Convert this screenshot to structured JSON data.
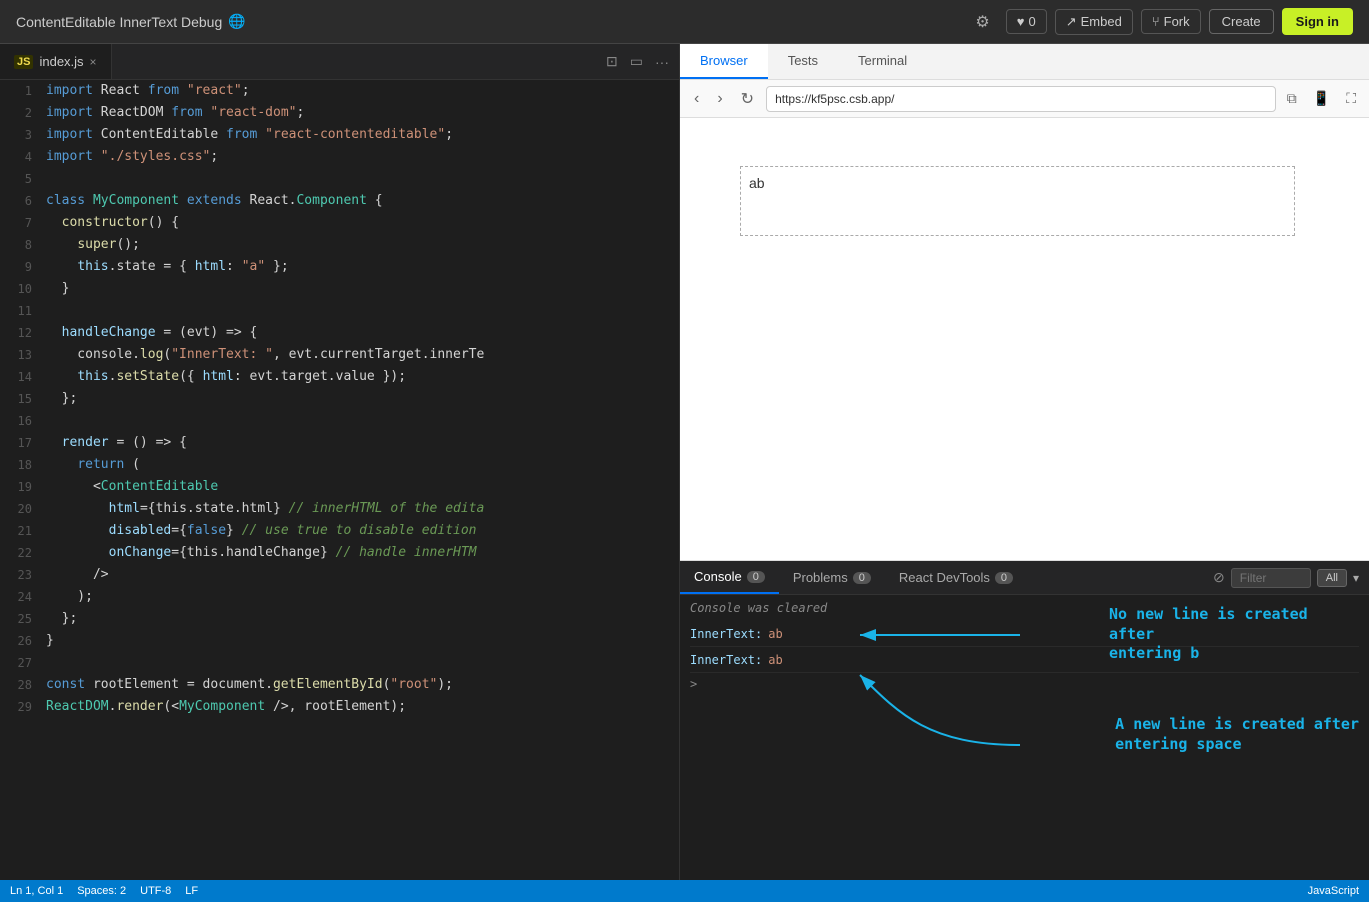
{
  "topbar": {
    "title": "ContentEditable InnerText Debug",
    "globe_icon": "🌐",
    "gear_label": "⚙",
    "likes_icon": "♥",
    "likes_count": "0",
    "embed_icon": "→",
    "embed_label": "Embed",
    "fork_icon": "⑂",
    "fork_label": "Fork",
    "create_label": "Create",
    "signin_label": "Sign in"
  },
  "editor": {
    "tab_label": "index.js",
    "js_badge": "JS"
  },
  "browser": {
    "tab_browser": "Browser",
    "tab_tests": "Tests",
    "tab_terminal": "Terminal",
    "url": "https://kf5psc.csb.app/",
    "content_text": "ab"
  },
  "console": {
    "tab_console": "Console",
    "tab_console_badge": "0",
    "tab_problems": "Problems",
    "tab_problems_badge": "0",
    "tab_devtools": "React DevTools",
    "tab_devtools_badge": "0",
    "filter_placeholder": "Filter",
    "filter_all": "All",
    "cleared_msg": "Console was cleared",
    "row1_label": "InnerText:",
    "row1_value": "ab",
    "row2_label": "InnerText:",
    "row2_value": "ab",
    "prompt": ">"
  },
  "annotations": {
    "annotation1": "No new line is created after\nentering b",
    "annotation2": "A new line is created after\nentering space"
  },
  "statusbar": {
    "position": "Ln 1, Col 1",
    "spaces": "Spaces: 2",
    "encoding": "UTF-8",
    "line_ending": "LF",
    "language": "JavaScript"
  },
  "code_lines": [
    {
      "num": "1",
      "tokens": [
        {
          "t": "kw",
          "v": "import"
        },
        {
          "t": "",
          "v": " React "
        },
        {
          "t": "kw",
          "v": "from"
        },
        {
          "t": "",
          "v": " "
        },
        {
          "t": "str",
          "v": "\"react\""
        },
        {
          "t": "",
          "v": ";"
        }
      ]
    },
    {
      "num": "2",
      "tokens": [
        {
          "t": "kw",
          "v": "import"
        },
        {
          "t": "",
          "v": " ReactDOM "
        },
        {
          "t": "kw",
          "v": "from"
        },
        {
          "t": "",
          "v": " "
        },
        {
          "t": "str",
          "v": "\"react-dom\""
        },
        {
          "t": "",
          "v": ";"
        }
      ]
    },
    {
      "num": "3",
      "tokens": [
        {
          "t": "kw",
          "v": "import"
        },
        {
          "t": "",
          "v": " ContentEditable "
        },
        {
          "t": "kw",
          "v": "from"
        },
        {
          "t": "",
          "v": " "
        },
        {
          "t": "str",
          "v": "\"react-contenteditable\""
        },
        {
          "t": "",
          "v": ";"
        }
      ]
    },
    {
      "num": "4",
      "tokens": [
        {
          "t": "kw",
          "v": "import"
        },
        {
          "t": "",
          "v": " "
        },
        {
          "t": "str",
          "v": "\"./styles.css\""
        },
        {
          "t": "",
          "v": ";"
        }
      ]
    },
    {
      "num": "5",
      "tokens": []
    },
    {
      "num": "6",
      "tokens": [
        {
          "t": "kw",
          "v": "class"
        },
        {
          "t": "",
          "v": " "
        },
        {
          "t": "cls",
          "v": "MyComponent"
        },
        {
          "t": "",
          "v": " "
        },
        {
          "t": "kw",
          "v": "extends"
        },
        {
          "t": "",
          "v": " React."
        },
        {
          "t": "cls",
          "v": "Component"
        },
        {
          "t": "",
          "v": " {"
        }
      ]
    },
    {
      "num": "7",
      "tokens": [
        {
          "t": "",
          "v": "  "
        },
        {
          "t": "fn",
          "v": "constructor"
        },
        {
          "t": "",
          "v": "() {"
        }
      ]
    },
    {
      "num": "8",
      "tokens": [
        {
          "t": "",
          "v": "    "
        },
        {
          "t": "fn",
          "v": "super"
        },
        {
          "t": "",
          "v": "();"
        }
      ]
    },
    {
      "num": "9",
      "tokens": [
        {
          "t": "",
          "v": "    "
        },
        {
          "t": "prop",
          "v": "this"
        },
        {
          "t": "",
          "v": ".state = { "
        },
        {
          "t": "prop",
          "v": "html"
        },
        {
          "t": "",
          "v": ": "
        },
        {
          "t": "str",
          "v": "\"a\""
        },
        {
          "t": "",
          "v": " };"
        }
      ]
    },
    {
      "num": "10",
      "tokens": [
        {
          "t": "",
          "v": "  }"
        }
      ]
    },
    {
      "num": "11",
      "tokens": []
    },
    {
      "num": "12",
      "tokens": [
        {
          "t": "",
          "v": "  "
        },
        {
          "t": "prop",
          "v": "handleChange"
        },
        {
          "t": "",
          "v": " = (evt) => {"
        }
      ]
    },
    {
      "num": "13",
      "tokens": [
        {
          "t": "",
          "v": "    console."
        },
        {
          "t": "fn",
          "v": "log"
        },
        {
          "t": "",
          "v": "("
        },
        {
          "t": "str",
          "v": "\"InnerText: \""
        },
        {
          "t": "",
          "v": ", evt.currentTarget.innerTe"
        }
      ]
    },
    {
      "num": "14",
      "tokens": [
        {
          "t": "",
          "v": "    "
        },
        {
          "t": "prop",
          "v": "this"
        },
        {
          "t": "",
          "v": "."
        },
        {
          "t": "fn",
          "v": "setState"
        },
        {
          "t": "",
          "v": "({ "
        },
        {
          "t": "prop",
          "v": "html"
        },
        {
          "t": "",
          "v": ": evt.target.value });"
        }
      ]
    },
    {
      "num": "15",
      "tokens": [
        {
          "t": "",
          "v": "  };"
        }
      ]
    },
    {
      "num": "16",
      "tokens": []
    },
    {
      "num": "17",
      "tokens": [
        {
          "t": "",
          "v": "  "
        },
        {
          "t": "prop",
          "v": "render"
        },
        {
          "t": "",
          "v": " = () => {"
        }
      ]
    },
    {
      "num": "18",
      "tokens": [
        {
          "t": "",
          "v": "    "
        },
        {
          "t": "kw",
          "v": "return"
        },
        {
          "t": "",
          "v": " ("
        }
      ]
    },
    {
      "num": "19",
      "tokens": [
        {
          "t": "",
          "v": "      <"
        },
        {
          "t": "cls",
          "v": "ContentEditable"
        }
      ]
    },
    {
      "num": "20",
      "tokens": [
        {
          "t": "",
          "v": "        "
        },
        {
          "t": "prop",
          "v": "html"
        },
        {
          "t": "",
          "v": "={this.state.html} "
        },
        {
          "t": "comment",
          "v": "// innerHTML of the edita"
        }
      ]
    },
    {
      "num": "21",
      "tokens": [
        {
          "t": "",
          "v": "        "
        },
        {
          "t": "prop",
          "v": "disabled"
        },
        {
          "t": "",
          "v": "={"
        },
        {
          "t": "kw",
          "v": "false"
        },
        {
          "t": "",
          "v": "} "
        },
        {
          "t": "comment",
          "v": "// use true to disable edition"
        }
      ]
    },
    {
      "num": "22",
      "tokens": [
        {
          "t": "",
          "v": "        "
        },
        {
          "t": "prop",
          "v": "onChange"
        },
        {
          "t": "",
          "v": "={this.handleChange} "
        },
        {
          "t": "comment",
          "v": "// handle innerHTM"
        }
      ]
    },
    {
      "num": "23",
      "tokens": [
        {
          "t": "",
          "v": "      />"
        }
      ]
    },
    {
      "num": "24",
      "tokens": [
        {
          "t": "",
          "v": "    );"
        }
      ]
    },
    {
      "num": "25",
      "tokens": [
        {
          "t": "",
          "v": "  };"
        }
      ]
    },
    {
      "num": "26",
      "tokens": [
        {
          "t": "",
          "v": "}"
        }
      ]
    },
    {
      "num": "27",
      "tokens": []
    },
    {
      "num": "28",
      "tokens": [
        {
          "t": "kw",
          "v": "const"
        },
        {
          "t": "",
          "v": " rootElement = document."
        },
        {
          "t": "fn",
          "v": "getElementById"
        },
        {
          "t": "",
          "v": "("
        },
        {
          "t": "str",
          "v": "\"root\""
        },
        {
          "t": "",
          "v": ");"
        }
      ]
    },
    {
      "num": "29",
      "tokens": [
        {
          "t": "cls",
          "v": "ReactDOM"
        },
        {
          "t": "",
          "v": "."
        },
        {
          "t": "fn",
          "v": "render"
        },
        {
          "t": "",
          "v": "(<"
        },
        {
          "t": "cls",
          "v": "MyComponent"
        },
        {
          "t": "",
          "v": " />, rootElement);"
        }
      ]
    }
  ]
}
